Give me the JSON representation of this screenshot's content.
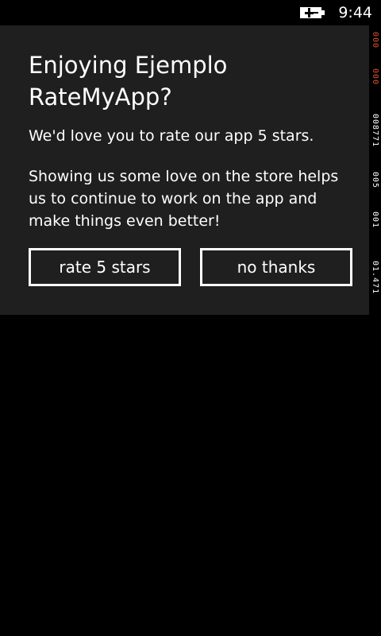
{
  "status_bar": {
    "time": "9:44",
    "battery_icon": "battery-charging-icon"
  },
  "dialog": {
    "title": "Enjoying Ejemplo RateMyApp?",
    "message": "We'd love you to rate our app 5 stars.",
    "body": "Showing us some love on the store helps us to continue to work on the app and make things even better!",
    "buttons": {
      "rate_label": "rate 5 stars",
      "no_thanks_label": "no thanks"
    }
  },
  "debug_overlay": {
    "counters": [
      {
        "value": "000",
        "color": "#e05030"
      },
      {
        "value": "000",
        "color": "#e05030"
      },
      {
        "value": "008771",
        "color": "#ffffff"
      },
      {
        "value": "005",
        "color": "#ffffff"
      },
      {
        "value": "001",
        "color": "#ffffff"
      },
      {
        "value": "01.471",
        "color": "#ffffff"
      }
    ]
  },
  "colors": {
    "dialog_background": "#1f1f1f",
    "page_background": "#000000",
    "foreground": "#ffffff"
  }
}
